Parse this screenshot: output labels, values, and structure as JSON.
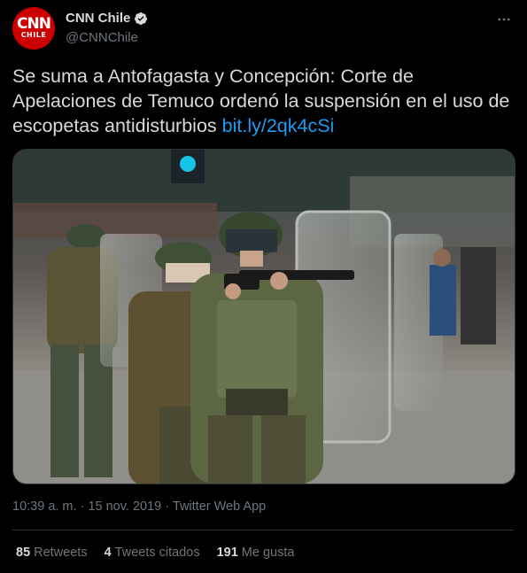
{
  "author": {
    "display_name": "CNN Chile",
    "handle": "@CNNChile",
    "avatar_logo_top": "CNN",
    "avatar_logo_bottom": "CHILE",
    "avatar_color": "#cc0000",
    "verified": true
  },
  "tweet": {
    "text": "Se suma a Antofagasta y Concepción: Corte de Apelaciones de Temuco ordenó la suspensión en el uso de escopetas antidisturbios",
    "link": "bit.ly/2qk4cSi",
    "link_color": "#1d9bf0"
  },
  "meta": {
    "time": "10:39 a. m.",
    "separator": "·",
    "date": "15 nov. 2019",
    "source": "Twitter Web App"
  },
  "stats": [
    {
      "count": "85",
      "label": "Retweets"
    },
    {
      "count": "4",
      "label": "Tweets citados"
    },
    {
      "count": "191",
      "label": "Me gusta"
    }
  ],
  "icons": {
    "more": "more-dots-icon",
    "verified": "verified-badge-icon"
  }
}
